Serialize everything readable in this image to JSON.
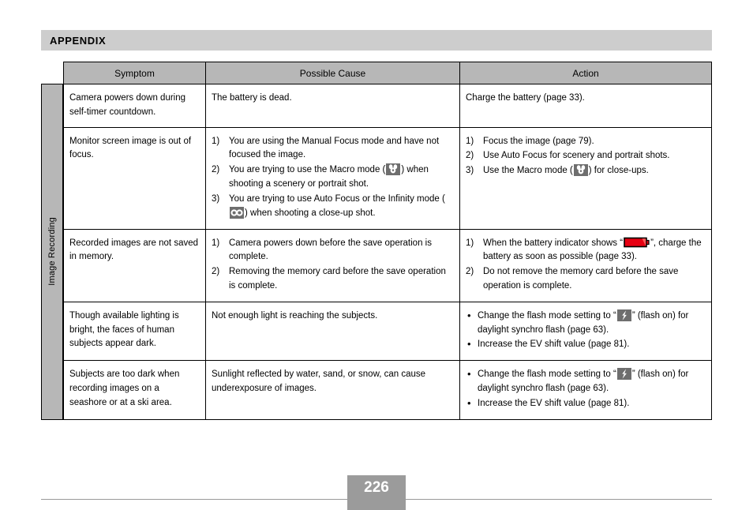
{
  "page": {
    "section_title": "APPENDIX",
    "page_number": "226",
    "category_label": "Image Recording",
    "colors": {
      "band": "#cdcdcd",
      "table_header": "#b7b7b7",
      "strip": "#b7b7b7",
      "page_box": "#9b9b9b",
      "icon_box": "#6e6e6e",
      "battery_red": "#e60012",
      "rule": "#9a9a9a"
    }
  },
  "table": {
    "columns": [
      "Symptom",
      "Possible Cause",
      "Action"
    ],
    "rows": [
      {
        "symptom": "Camera powers down during self-timer countdown.",
        "cause_type": "text",
        "cause_text": "The battery is dead.",
        "action_type": "text",
        "action_text": "Charge the battery (page 33)."
      },
      {
        "symptom": "Monitor screen image is out of focus.",
        "cause_type": "numbered",
        "cause_items": [
          {
            "marker": "1)",
            "pre": "You are using the Manual Focus mode and have not focused the image.",
            "icon": "",
            "post": ""
          },
          {
            "marker": "2)",
            "pre": "You are trying to use the Macro mode (",
            "icon": "macro-flower-icon",
            "post": ") when shooting a scenery or portrait shot."
          },
          {
            "marker": "3)",
            "pre": "You are trying to use Auto Focus or the Infinity mode (",
            "icon": "infinity-icon",
            "post": ") when shooting a close-up shot."
          }
        ],
        "action_type": "numbered",
        "action_items": [
          {
            "marker": "1)",
            "pre": "Focus the image (page 79).",
            "icon": "",
            "post": ""
          },
          {
            "marker": "2)",
            "pre": "Use Auto Focus for scenery and portrait shots.",
            "icon": "",
            "post": ""
          },
          {
            "marker": "3)",
            "pre": "Use the Macro mode (",
            "icon": "macro-flower-icon",
            "post": ") for close-ups."
          }
        ]
      },
      {
        "symptom": "Recorded images are not saved in memory.",
        "cause_type": "numbered",
        "cause_items": [
          {
            "marker": "1)",
            "pre": "Camera powers down before the save operation is complete.",
            "icon": "",
            "post": ""
          },
          {
            "marker": "2)",
            "pre": "Removing the memory card before the save operation is complete.",
            "icon": "",
            "post": ""
          }
        ],
        "action_type": "numbered",
        "action_items": [
          {
            "marker": "1)",
            "pre": "When the battery indicator shows “",
            "icon": "battery-empty-icon",
            "post": "”, charge the battery as soon as possible (page 33)."
          },
          {
            "marker": "2)",
            "pre": "Do not remove the memory card before the save operation is complete.",
            "icon": "",
            "post": ""
          }
        ]
      },
      {
        "symptom": "Though available lighting is bright, the faces of human subjects appear dark.",
        "cause_type": "text",
        "cause_text": "Not enough light is reaching the subjects.",
        "action_type": "bulleted",
        "action_items": [
          {
            "marker": "•",
            "pre": "Change the flash mode setting to “",
            "icon": "flash-on-icon",
            "post": "” (flash on) for daylight synchro flash (page 63)."
          },
          {
            "marker": "•",
            "pre": "Increase the EV shift value (page 81).",
            "icon": "",
            "post": ""
          }
        ]
      },
      {
        "symptom": "Subjects are too dark when recording images on a seashore or at a ski area.",
        "cause_type": "text",
        "cause_text": "Sunlight reflected by water, sand, or snow, can cause underexposure of images.",
        "action_type": "bulleted",
        "action_items": [
          {
            "marker": "•",
            "pre": "Change the flash mode setting to “",
            "icon": "flash-on-icon",
            "post": "” (flash on) for daylight synchro flash (page 63)."
          },
          {
            "marker": "•",
            "pre": "Increase the EV shift value (page 81).",
            "icon": "",
            "post": ""
          }
        ]
      }
    ]
  }
}
